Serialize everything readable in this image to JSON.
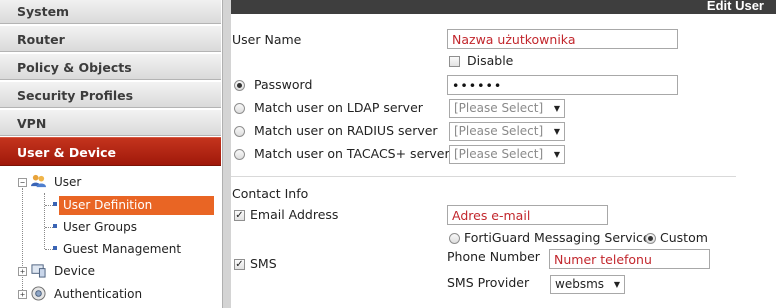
{
  "sidebar": {
    "items": [
      {
        "label": "System"
      },
      {
        "label": "Router"
      },
      {
        "label": "Policy & Objects"
      },
      {
        "label": "Security Profiles"
      },
      {
        "label": "VPN"
      },
      {
        "label": "User & Device"
      }
    ],
    "tree": {
      "user": {
        "label": "User",
        "children": [
          "User Definition",
          "User Groups",
          "Guest Management"
        ],
        "selected": "User Definition"
      },
      "device": {
        "label": "Device"
      },
      "authentication": {
        "label": "Authentication"
      }
    }
  },
  "header": {
    "title": "Edit User"
  },
  "form": {
    "username_label": "User Name",
    "username_value": "Nazwa użutkownika",
    "disable_label": "Disable",
    "password_label": "Password",
    "password_value": "••••••",
    "ldap_label": "Match user on LDAP server",
    "radius_label": "Match user on RADIUS server",
    "tacacs_label": "Match user on TACACS+ server",
    "please_select": "[Please Select]",
    "contact_info_label": "Contact Info",
    "email_label": "Email Address",
    "email_value": "Adres e-mail",
    "sms_label": "SMS",
    "fortiguard_label": "FortiGuard Messaging Service",
    "custom_label": "Custom",
    "phone_label": "Phone Number",
    "phone_value": "Numer telefonu",
    "sms_provider_label": "SMS Provider",
    "sms_provider_value": "websms"
  },
  "colors": {
    "accent": "#b0220f",
    "selection": "#e96524",
    "title_bar": "#3e3e3e",
    "placeholder_text": "#c2272d"
  }
}
